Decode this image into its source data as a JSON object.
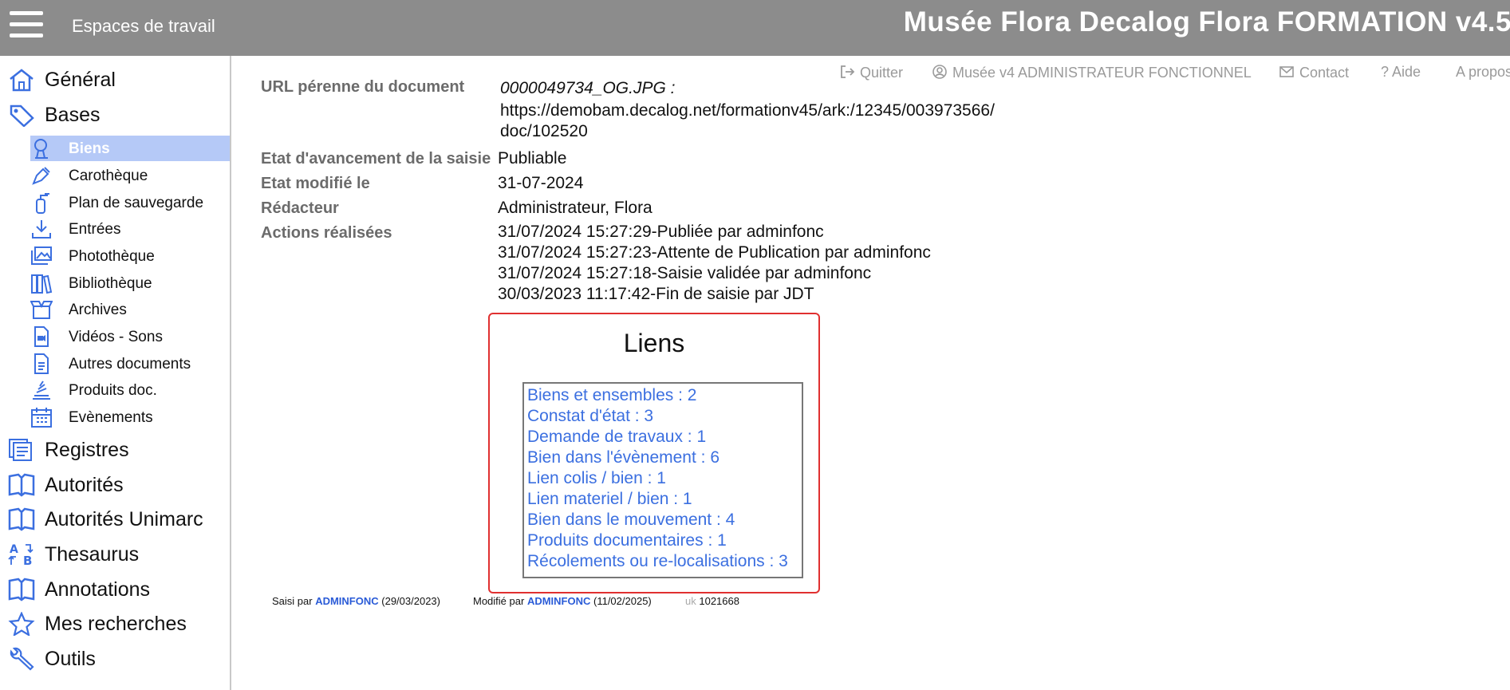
{
  "header": {
    "workspaces_label": "Espaces de travail",
    "app_title": "Musée Flora Decalog Flora FORMATION v4.5"
  },
  "toplinks": {
    "quit": "Quitter",
    "user": "Musée v4 ADMINISTRATEUR FONCTIONNEL",
    "contact": "Contact",
    "help": "Aide",
    "about": "A propos"
  },
  "sidebar": {
    "general": "Général",
    "bases": "Bases",
    "bases_items": [
      "Biens",
      "Carothèque",
      "Plan de sauvegarde",
      "Entrées",
      "Photothèque",
      "Bibliothèque",
      "Archives",
      "Vidéos - Sons",
      "Autres documents",
      "Produits doc.",
      "Evènements"
    ],
    "registres": "Registres",
    "autorites": "Autorités",
    "autorites_unimarc": "Autorités Unimarc",
    "thesaurus": "Thesaurus",
    "annotations": "Annotations",
    "mes_recherches": "Mes recherches",
    "outils": "Outils"
  },
  "record": {
    "url_label": "URL pérenne du document",
    "url_lines": [
      "0000049734_OG.JPG :",
      "https://demobam.decalog.net/formationv45/ark:/12345/003973566/",
      "doc/102520"
    ],
    "etat_label": "Etat d'avancement de la saisie",
    "etat_value": "Publiable",
    "modifie_label": "Etat modifié le",
    "modifie_value": "31-07-2024",
    "redacteur_label": "Rédacteur",
    "redacteur_value": "Administrateur, Flora",
    "actions_label": "Actions réalisées",
    "actions": [
      "31/07/2024 15:27:29-Publiée par adminfonc",
      "31/07/2024 15:27:23-Attente de Publication par adminfonc",
      "31/07/2024 15:27:18-Saisie validée par adminfonc",
      "30/03/2023 11:17:42-Fin de saisie par JDT"
    ]
  },
  "liens": {
    "title": "Liens",
    "items": [
      "Biens et ensembles : 2",
      "Constat d'état : 3",
      "Demande de travaux : 1",
      "Bien dans l'évènement : 6",
      "Lien colis / bien : 1",
      "Lien materiel / bien : 1",
      "Bien dans le mouvement : 4",
      "Produits documentaires : 1",
      "Récolements ou re-localisations : 3"
    ]
  },
  "footer": {
    "saisi_prefix": "Saisi par",
    "saisi_user": "ADMINFONC",
    "saisi_date": "(29/03/2023)",
    "modifie_prefix": "Modifié par",
    "modifie_user": "ADMINFONC",
    "modifie_date": "(11/02/2025)",
    "uk_label": "uk",
    "uk_value": "1021668"
  },
  "colors": {
    "accent": "#3b6fe0",
    "active_bg": "#b5c9f7",
    "topbar": "#8c8c8c",
    "highlight_border": "#e03030"
  }
}
